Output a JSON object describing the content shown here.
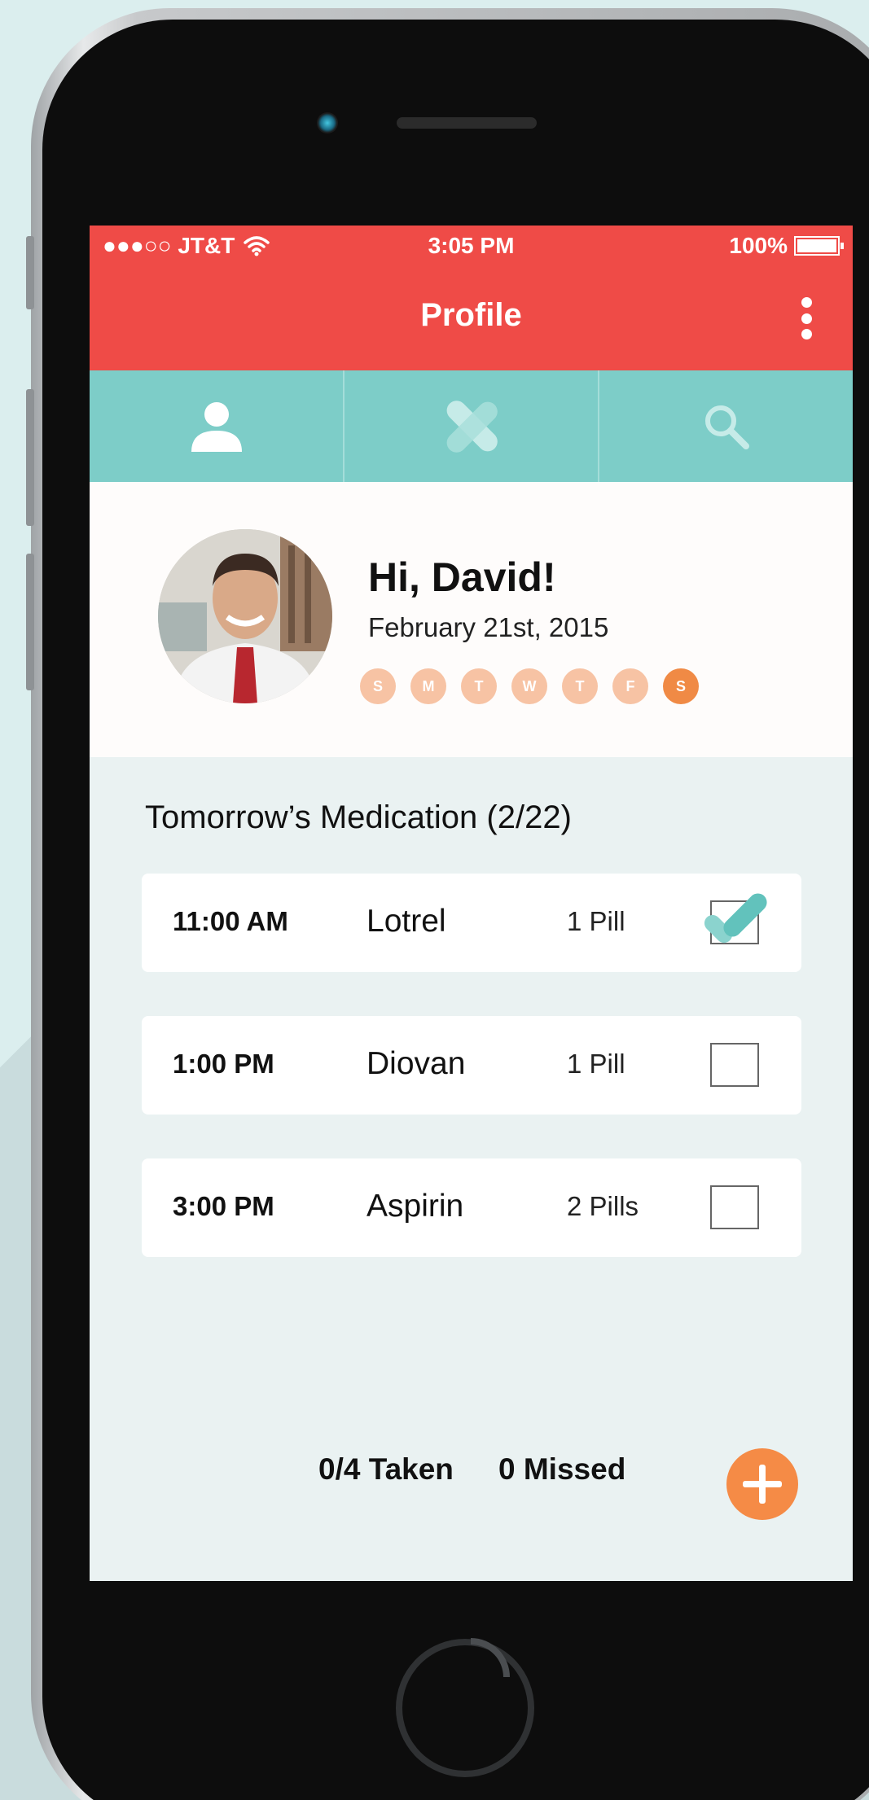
{
  "status_bar": {
    "carrier": "●●●○○ JT&T",
    "time": "3:05 PM",
    "battery": "100%"
  },
  "header": {
    "title": "Profile"
  },
  "tabs": [
    {
      "icon": "person-icon",
      "active": true
    },
    {
      "icon": "bandage-icon",
      "active": false
    },
    {
      "icon": "search-icon",
      "active": false
    }
  ],
  "profile": {
    "greeting": "Hi, David!",
    "date": "February 21st, 2015",
    "days": [
      {
        "label": "S",
        "active": false
      },
      {
        "label": "M",
        "active": false
      },
      {
        "label": "T",
        "active": false
      },
      {
        "label": "W",
        "active": false
      },
      {
        "label": "T",
        "active": false
      },
      {
        "label": "F",
        "active": false
      },
      {
        "label": "S",
        "active": true
      }
    ]
  },
  "medication": {
    "title": "Tomorrow’s Medication (2/22)",
    "items": [
      {
        "time": "11:00 AM",
        "name": "Lotrel",
        "dose": "1 Pill",
        "checked": true
      },
      {
        "time": "1:00 PM",
        "name": "Diovan",
        "dose": "1 Pill",
        "checked": false
      },
      {
        "time": "3:00 PM",
        "name": "Aspirin",
        "dose": "2 Pills",
        "checked": false
      }
    ]
  },
  "summary": {
    "taken": "0/4 Taken",
    "missed": "0 Missed"
  },
  "colors": {
    "header": "#ef4b47",
    "tabs": "#7dcdc8",
    "accent": "#f58b46"
  }
}
